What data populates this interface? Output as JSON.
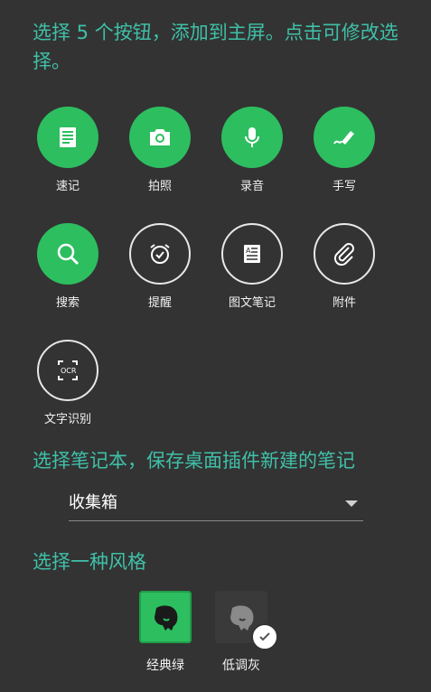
{
  "header": {
    "instruction": "选择 5 个按钮，添加到主屏。点击可修改选择。"
  },
  "buttons": [
    {
      "label": "速记",
      "icon": "note-icon",
      "selected": true
    },
    {
      "label": "拍照",
      "icon": "camera-icon",
      "selected": true
    },
    {
      "label": "录音",
      "icon": "microphone-icon",
      "selected": true
    },
    {
      "label": "手写",
      "icon": "handwriting-icon",
      "selected": true
    },
    {
      "label": "搜索",
      "icon": "search-icon",
      "selected": true
    },
    {
      "label": "提醒",
      "icon": "alarm-clock-icon",
      "selected": false
    },
    {
      "label": "图文笔记",
      "icon": "text-image-note-icon",
      "selected": false
    },
    {
      "label": "附件",
      "icon": "paperclip-icon",
      "selected": false
    },
    {
      "label": "文字识别",
      "icon": "ocr-icon",
      "selected": false
    }
  ],
  "notebook": {
    "title": "选择笔记本，保存桌面插件新建的笔记",
    "selected": "收集箱"
  },
  "style": {
    "title": "选择一种风格",
    "options": [
      {
        "label": "经典绿",
        "icon": "elephant-logo-icon",
        "selected": false
      },
      {
        "label": "低调灰",
        "icon": "elephant-logo-icon",
        "selected": true
      }
    ]
  },
  "colors": {
    "accent": "#3fc0a8",
    "green": "#2dbe60",
    "background": "#333333"
  }
}
